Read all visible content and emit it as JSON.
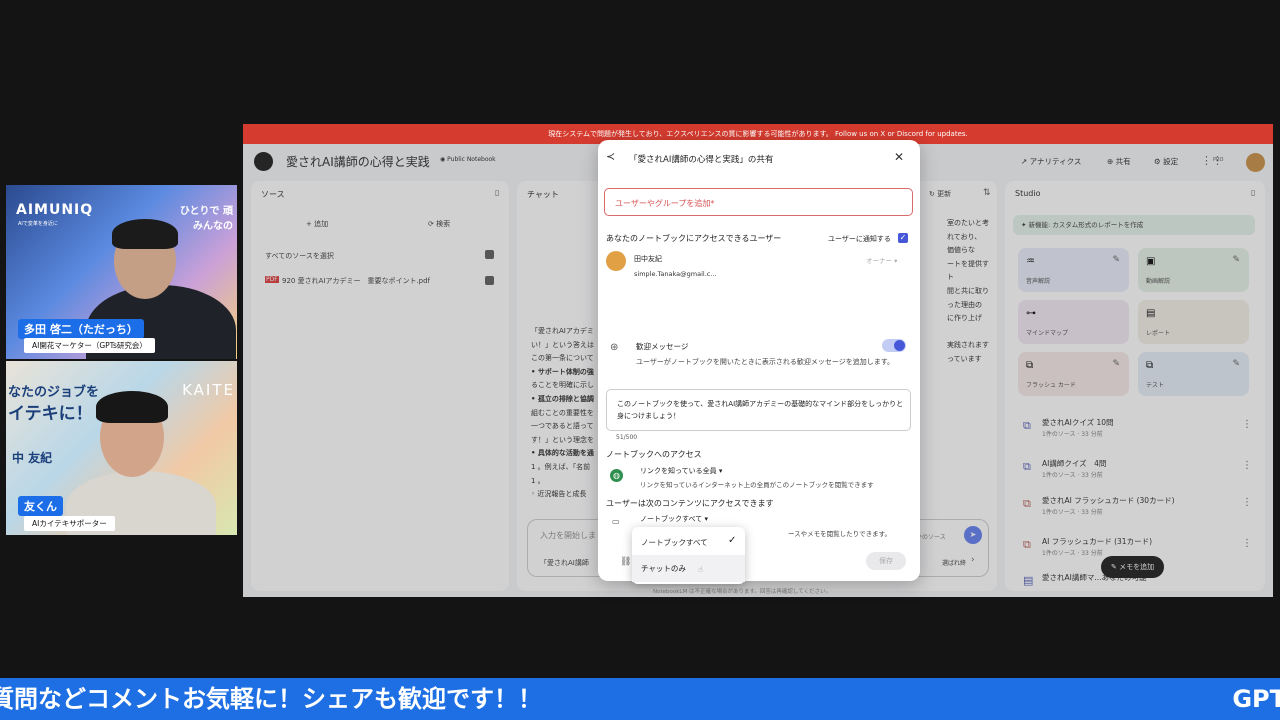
{
  "cam1": {
    "logo": "AIMUNIQ",
    "logo_sub": "AIで変革を身近に",
    "side_text_1": "ひとりで 頑",
    "side_text_2": "みんなの",
    "name": "多田 啓二（ただっち）",
    "role": "AI開花マーケター（GPTs研究会）"
  },
  "cam2": {
    "side_text_1": "なたのジョブを",
    "side_text_2": "イテキに！",
    "side_text_3": "KAITE",
    "side_text_4": "中 友紀",
    "name": "友くん",
    "role": "AIカイテキサポーター"
  },
  "ticker": {
    "text": "質問などコメントお気軽に！シェアも歓迎です！！",
    "right": "GPT"
  },
  "app": {
    "banner": "現在システムで問題が発生しており、エクスペリエンスの質に影響する可能性があります。 Follow us on X or Discord for updates.",
    "notebook_title": "愛されAI講師の心得と実践",
    "public_badge": "Public Notebook",
    "analytics": "アナリティクス",
    "share": "共有",
    "settings": "設定",
    "pro": "PRO",
    "sources": {
      "title": "ソース",
      "add": "追加",
      "search": "検索",
      "select_all": "すべてのソースを選択",
      "file": "920 愛されAIアカデミー　重要なポイント.pdf"
    },
    "chat": {
      "title": "チャット",
      "refresh": "更新",
      "lines": [
        "「愛されAIアカデミ",
        "い！」という答えは",
        "この第一条について",
        "• サポート体制の強",
        "ることを明確に示し",
        "• 孤立の排除と協調",
        "組むことの重要性を",
        "一つであると語って",
        "す！」という理念を",
        "• 具体的な活動を通",
        "1 。例えば、「名前",
        "1 。",
        "◦ 近況報告と成長"
      ],
      "right_lines": [
        "室のたいと考",
        "れており、",
        "価値らな",
        "ートを提供す",
        "ト",
        "間と共に取り",
        "った理由の",
        "に作り上げ",
        "",
        "実践されます",
        "っています"
      ],
      "input_placeholder": "入力を開始しま",
      "sources_count": "件のソース",
      "suggest": "「愛されAI講師",
      "suggest_right": "選ばれ終"
    },
    "studio": {
      "title": "Studio",
      "create_report": "新機能: カスタム形式のレポートを作成",
      "tiles": [
        {
          "label": "音声解説",
          "icon": "audio-icon"
        },
        {
          "label": "動画解説",
          "icon": "video-icon"
        },
        {
          "label": "マインドマップ",
          "icon": "mindmap-icon"
        },
        {
          "label": "レポート",
          "icon": "report-icon"
        },
        {
          "label": "フラッシュ カード",
          "icon": "flashcard-icon"
        },
        {
          "label": "テスト",
          "icon": "quiz-icon"
        }
      ],
      "notes": [
        {
          "title": "愛されAIクイズ 10問",
          "sub": "1件のソース · 33 分前"
        },
        {
          "title": "AI講師クイズ　4問",
          "sub": "1件のソース · 33 分前"
        },
        {
          "title": "愛されAI フラッシュカード (30カード)",
          "sub": "1件のソース · 33 分前"
        },
        {
          "title": "AI フラッシュカード (31カード)",
          "sub": "1件のソース · 33 分前"
        },
        {
          "title": "愛されAI講師マ...あなたの可能",
          "sub": ""
        }
      ],
      "add_note": "メモを追加"
    },
    "footer": "NotebookLM は不正確な場合があります。回答は再確認してください。"
  },
  "modal": {
    "title": "「愛されAI講師の心得と実践」の共有",
    "add_placeholder": "ユーザーやグループを追加*",
    "access_users_label": "あなたのノートブックにアクセスできるユーザー",
    "notify_label": "ユーザーに通知する",
    "user_name": "田中友紀",
    "user_email": "simple.Tanaka@gmail.c...",
    "user_role": "オーナー",
    "welcome_title": "歓迎メッセージ",
    "welcome_desc": "ユーザーがノートブックを開いたときに表示される歓迎メッセージを追加します。",
    "welcome_text": "このノートブックを使って、愛されAI講師アカデミーの基礎的なマインド部分をしっかりと身につけましょう！",
    "char_count": "51/500",
    "access_title": "ノートブックへのアクセス",
    "access_value": "リンクを知っている全員",
    "access_desc": "リンクを知っているインターネット上の全員がこのノートブックを閲覧できます",
    "content_title": "ユーザーは次のコンテンツにアクセスできます",
    "content_value": "ノートブックすべて",
    "content_desc": "ースやメモを閲覧したりできます。",
    "save": "保存",
    "dropdown_options": [
      "ノートブックすべて",
      "チャットのみ"
    ],
    "selected_option": "ノートブックすべて"
  }
}
